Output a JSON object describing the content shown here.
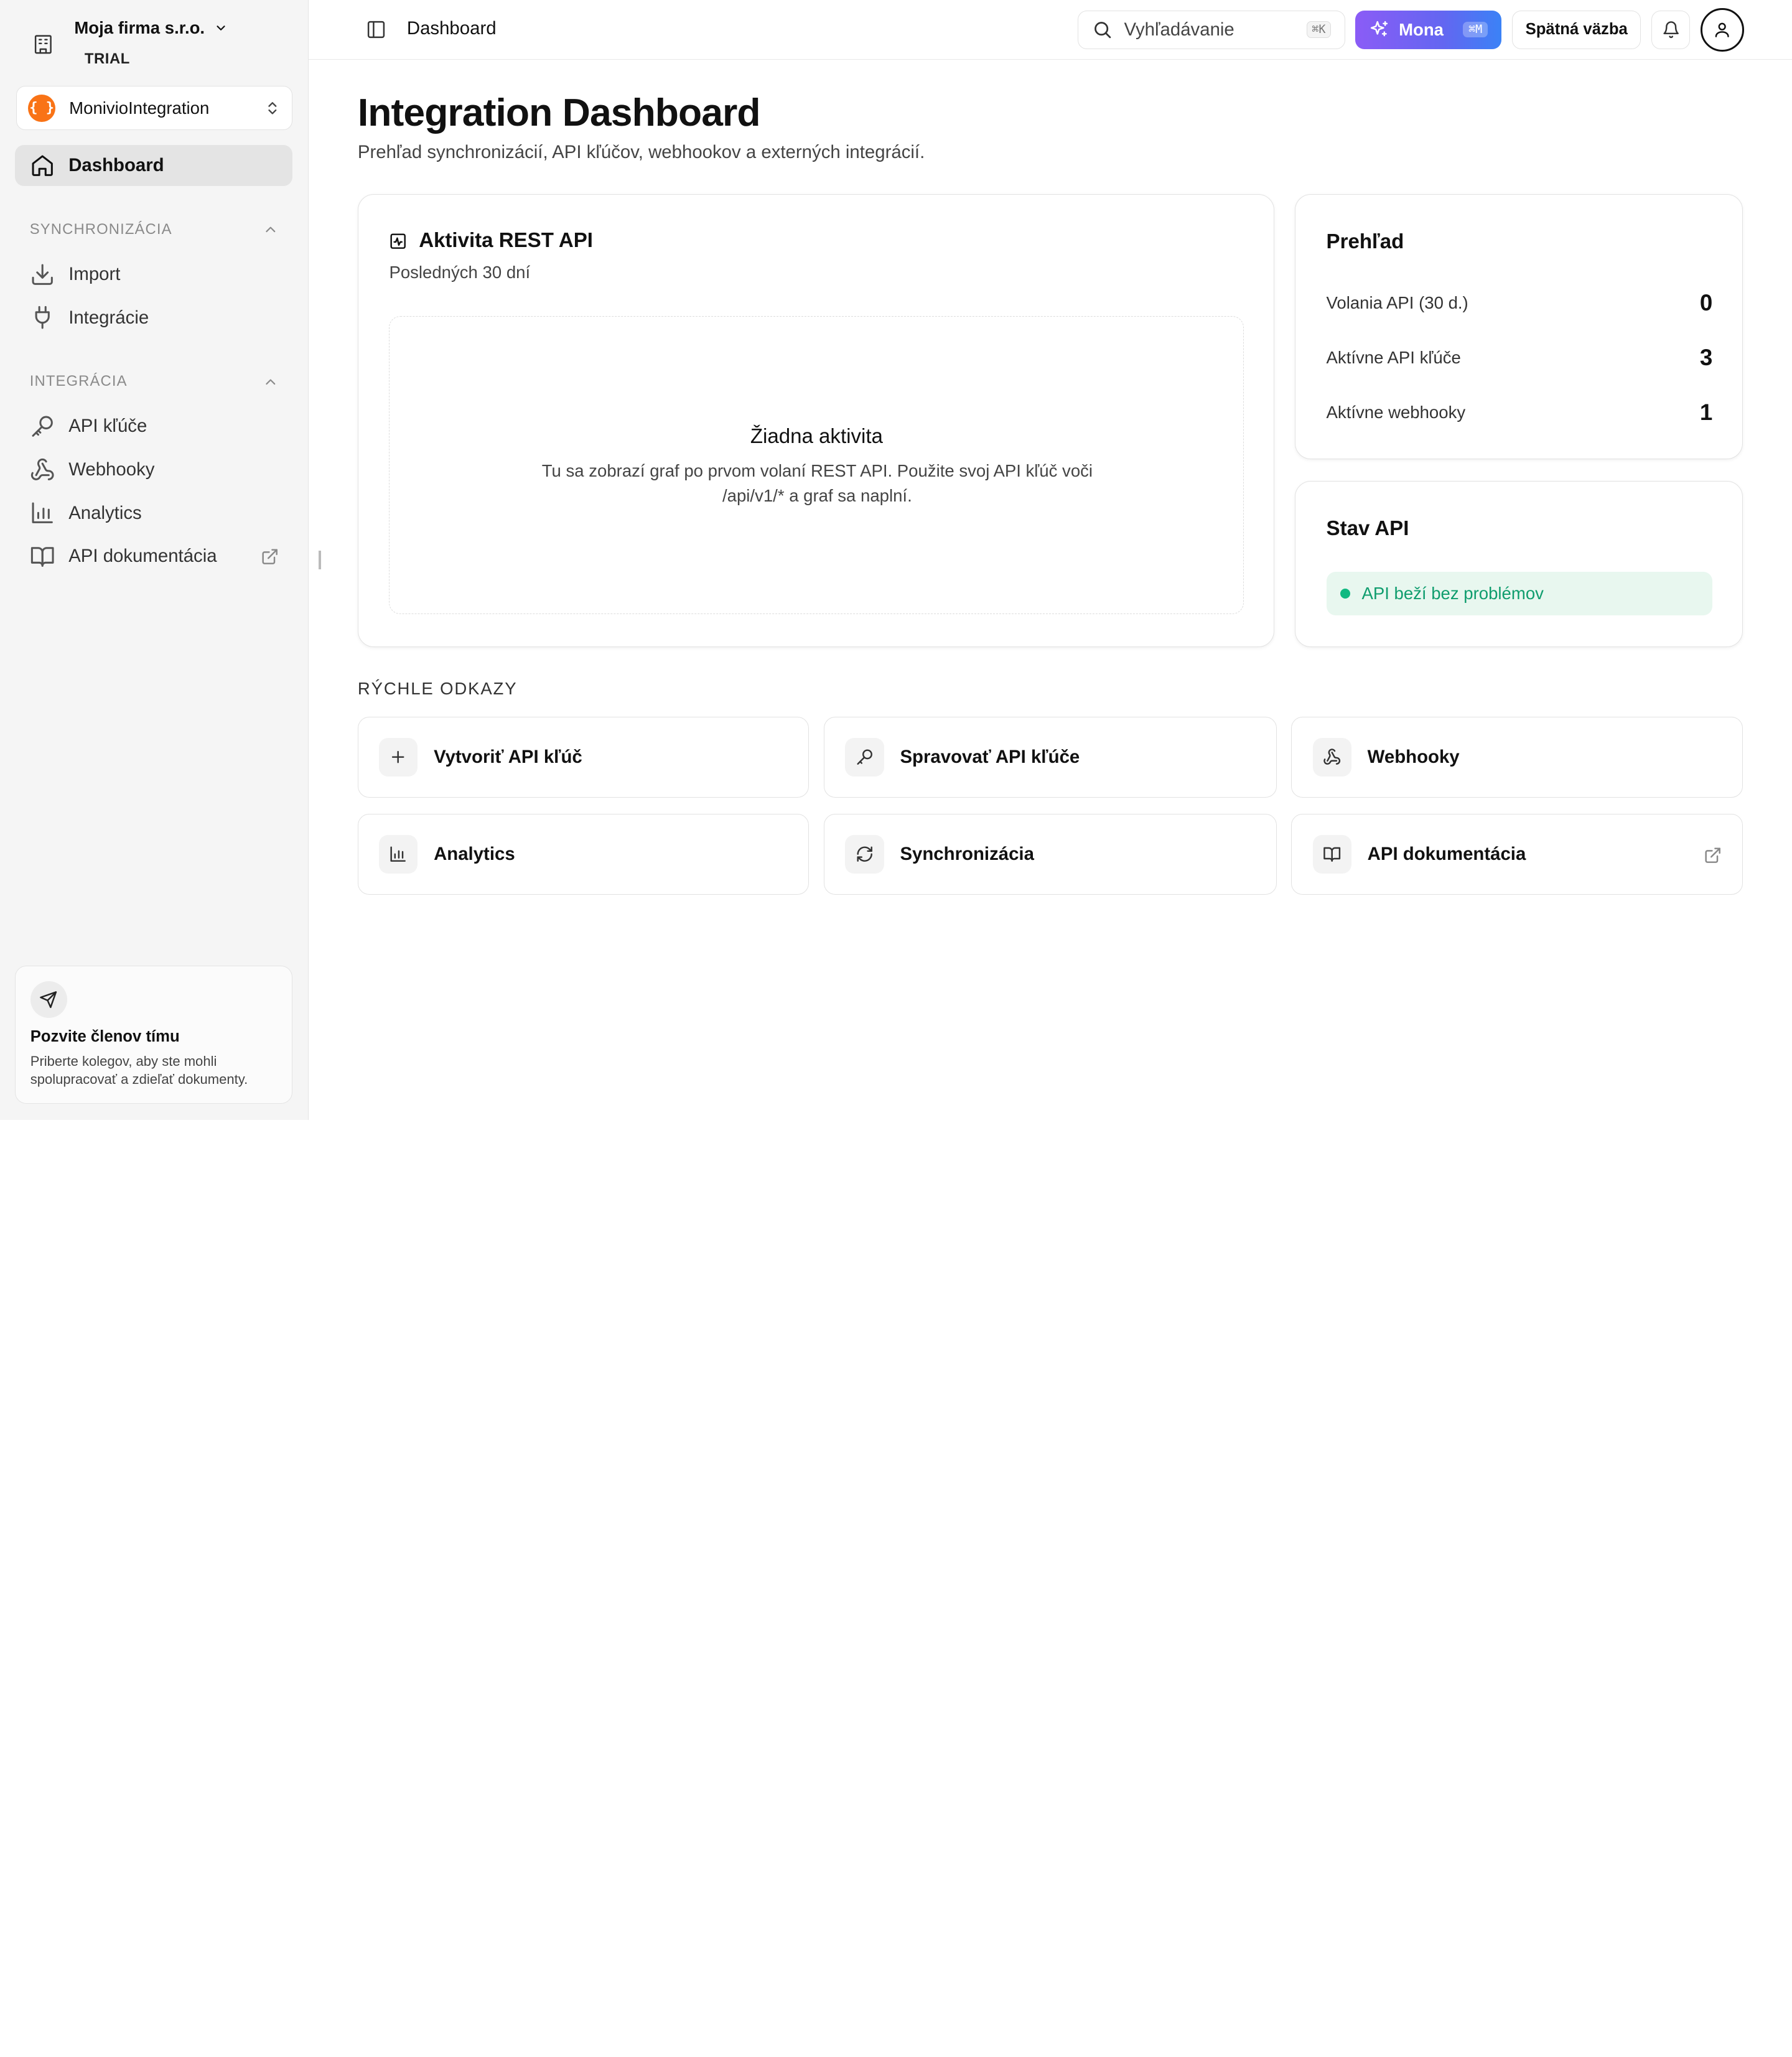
{
  "org": {
    "name": "Moja firma s.r.o.",
    "plan": "TRIAL"
  },
  "workspace": {
    "logo": "{ }",
    "name": "MonivioIntegration"
  },
  "sidebar": {
    "dashboard": "Dashboard",
    "sync_section": "SYNCHRONIZÁCIA",
    "import": "Import",
    "integrations": "Integrácie",
    "integration_section": "INTEGRÁCIA",
    "api_keys": "API kľúče",
    "webhooks": "Webhooky",
    "analytics": "Analytics",
    "api_docs": "API dokumentácia"
  },
  "invite": {
    "title": "Pozvite členov tímu",
    "text": "Priberte kolegov, aby ste mohli spolupracovať a zdieľať dokumenty."
  },
  "header": {
    "breadcrumb": "Dashboard",
    "search_placeholder": "Vyhľadávanie",
    "search_kbd": "⌘K",
    "mona_label": "Mona",
    "mona_kbd": "⌘M",
    "feedback": "Spätná väzba"
  },
  "page": {
    "title": "Integration Dashboard",
    "subtitle": "Prehľad synchronizácií, API kľúčov, webhookov a externých integrácií."
  },
  "activity": {
    "title": "Aktivita REST API",
    "period": "Posledných 30 dní",
    "empty_title": "Žiadna aktivita",
    "empty_text": "Tu sa zobrazí graf po prvom volaní REST API. Použite svoj API kľúč voči /api/v1/* a graf sa naplní."
  },
  "overview": {
    "title": "Prehľad",
    "stats": [
      {
        "label": "Volania API (30 d.)",
        "value": "0"
      },
      {
        "label": "Aktívne API kľúče",
        "value": "3"
      },
      {
        "label": "Aktívne webhooky",
        "value": "1"
      }
    ]
  },
  "api_status": {
    "title": "Stav API",
    "status": "API beží bez problémov",
    "status_color": "#10b981"
  },
  "quick_links": {
    "title": "RÝCHLE ODKAZY",
    "items": [
      {
        "label": "Vytvoriť API kľúč",
        "icon": "plus-icon"
      },
      {
        "label": "Spravovať API kľúče",
        "icon": "key-icon"
      },
      {
        "label": "Webhooky",
        "icon": "webhook-icon"
      },
      {
        "label": "Analytics",
        "icon": "bar-chart-icon"
      },
      {
        "label": "Synchronizácia",
        "icon": "refresh-icon"
      },
      {
        "label": "API dokumentácia",
        "icon": "book-icon"
      }
    ]
  },
  "colors": {
    "accent_start": "#8b5cf6",
    "accent_end": "#3b82f6",
    "workspace_logo": "#f97316"
  }
}
